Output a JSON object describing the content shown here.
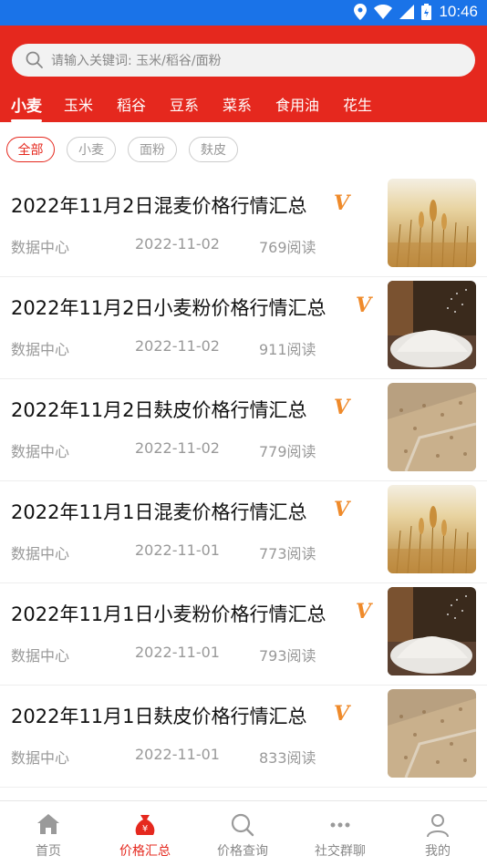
{
  "status": {
    "time": "10:46"
  },
  "search": {
    "placeholder": "请输入关键词: 玉米/稻谷/面粉"
  },
  "tabs": [
    {
      "label": "小麦",
      "active": true
    },
    {
      "label": "玉米"
    },
    {
      "label": "稻谷"
    },
    {
      "label": "豆系"
    },
    {
      "label": "菜系"
    },
    {
      "label": "食用油"
    },
    {
      "label": "花生"
    }
  ],
  "chips": [
    {
      "label": "全部",
      "active": true
    },
    {
      "label": "小麦"
    },
    {
      "label": "面粉"
    },
    {
      "label": "麸皮"
    }
  ],
  "articles": [
    {
      "title": "2022年11月2日混麦价格行情汇总",
      "badge": "V",
      "source": "数据中心",
      "date": "2022-11-02",
      "reads": "769阅读",
      "thumb": "wheat-field"
    },
    {
      "title": "2022年11月2日小麦粉价格行情汇总",
      "badge": "V",
      "source": "数据中心",
      "date": "2022-11-02",
      "reads": "911阅读",
      "thumb": "flour"
    },
    {
      "title": "2022年11月2日麸皮价格行情汇总",
      "badge": "V",
      "source": "数据中心",
      "date": "2022-11-02",
      "reads": "779阅读",
      "thumb": "bran"
    },
    {
      "title": "2022年11月1日混麦价格行情汇总",
      "badge": "V",
      "source": "数据中心",
      "date": "2022-11-01",
      "reads": "773阅读",
      "thumb": "wheat-field"
    },
    {
      "title": "2022年11月1日小麦粉价格行情汇总",
      "badge": "V",
      "source": "数据中心",
      "date": "2022-11-01",
      "reads": "793阅读",
      "thumb": "flour"
    },
    {
      "title": "2022年11月1日麸皮价格行情汇总",
      "badge": "V",
      "source": "数据中心",
      "date": "2022-11-01",
      "reads": "833阅读",
      "thumb": "bran"
    }
  ],
  "nav": [
    {
      "label": "首页",
      "icon": "home-icon"
    },
    {
      "label": "价格汇总",
      "icon": "price-bag-icon",
      "active": true
    },
    {
      "label": "价格查询",
      "icon": "search-icon"
    },
    {
      "label": "社交群聊",
      "icon": "chat-dots-icon"
    },
    {
      "label": "我的",
      "icon": "user-icon"
    }
  ],
  "colors": {
    "brand": "#e5281e",
    "statusbar": "#1a73e8",
    "badge": "#ef8a2a"
  }
}
